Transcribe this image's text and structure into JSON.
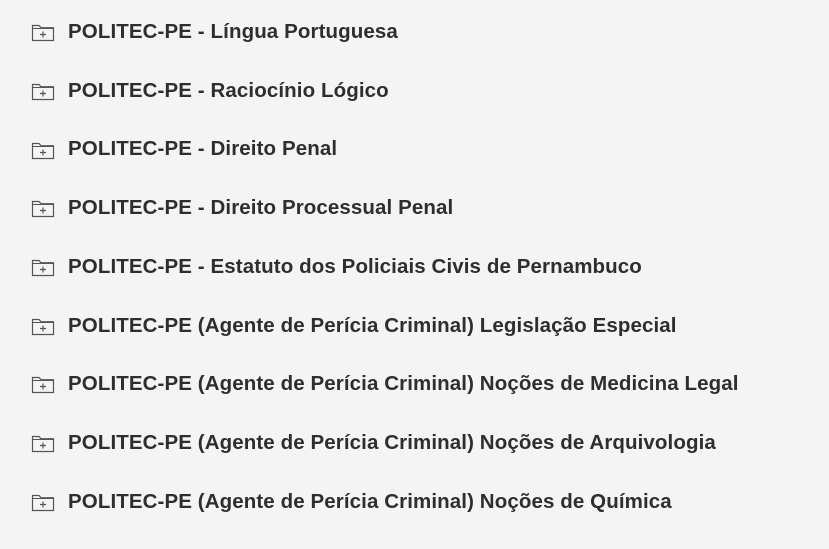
{
  "folders": [
    {
      "label": "POLITEC-PE - Língua Portuguesa",
      "icon": "folder-plus-icon"
    },
    {
      "label": "POLITEC-PE - Raciocínio Lógico",
      "icon": "folder-plus-icon"
    },
    {
      "label": "POLITEC-PE - Direito Penal",
      "icon": "folder-plus-icon"
    },
    {
      "label": "POLITEC-PE - Direito Processual Penal",
      "icon": "folder-plus-icon"
    },
    {
      "label": "POLITEC-PE - Estatuto dos Policiais Civis de Pernambuco",
      "icon": "folder-plus-icon"
    },
    {
      "label": "POLITEC-PE (Agente de Perícia Criminal) Legislação Especial",
      "icon": "folder-plus-icon"
    },
    {
      "label": "POLITEC-PE (Agente de Perícia Criminal) Noções de Medicina Legal",
      "icon": "folder-plus-icon"
    },
    {
      "label": "POLITEC-PE (Agente de Perícia Criminal) Noções de Arquivologia",
      "icon": "folder-plus-icon"
    },
    {
      "label": "POLITEC-PE (Agente de Perícia Criminal) Noções de Química",
      "icon": "folder-plus-icon"
    }
  ],
  "colors": {
    "background": "#f4f4f4",
    "text": "#2e2e2e",
    "icon_stroke": "#555555"
  }
}
